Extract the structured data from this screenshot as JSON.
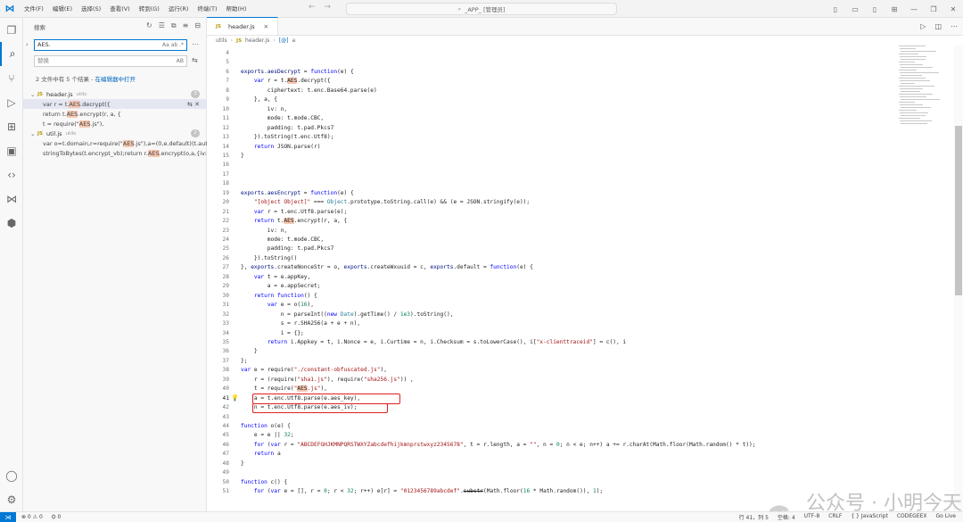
{
  "titlebar": {
    "menu": [
      "文件(F)",
      "编辑(E)",
      "选择(S)",
      "查看(V)",
      "转到(G)",
      "运行(R)",
      "终端(T)",
      "帮助(H)"
    ],
    "command_center": "_APP_ [管理员]"
  },
  "sidebar": {
    "title": "搜索",
    "search_value": "AES.",
    "search_options": "Aa ab .*",
    "replace_placeholder": "替换",
    "replace_option": "AB",
    "summary": "2 文件中有 5 个结果 - ",
    "summary_link": "在编辑器中打开",
    "files": [
      {
        "name": "header.js",
        "dir": "utils",
        "count": "3",
        "matches": [
          {
            "pre": "var r = t.",
            "hit": "AES",
            "post": ".decrypt({"
          },
          {
            "pre": "return t.",
            "hit": "AES",
            "post": ".encrypt(r, a, {"
          },
          {
            "pre": "t = require(\"",
            "hit": "AES",
            "post": ".js\"),"
          }
        ]
      },
      {
        "name": "util.js",
        "dir": "utils",
        "count": "2",
        "matches": [
          {
            "pre": "var o=t.domain,r=require(\"",
            "hit": "AES",
            "post": ".js\"),a=(0,e.default)(t.aut..."
          },
          {
            "pre": "stringToBytes(t.encrypt_vb);return r.",
            "hit": "AES",
            "post": ".encrypt(o,a,{iv:s..."
          }
        ]
      }
    ]
  },
  "editor": {
    "tab_label": "header.js",
    "breadcrumb": [
      "utils",
      "header.js",
      "a"
    ],
    "current_line": 41
  },
  "code_lines": [
    [
      4,
      []
    ],
    [
      5,
      []
    ],
    [
      6,
      [
        [
          "prop",
          "exports"
        ],
        [
          "",
          "."
        ],
        [
          "prop",
          "aesDecrypt"
        ],
        [
          "",
          " = "
        ],
        [
          "kw",
          "function"
        ],
        [
          "",
          "(e) {"
        ]
      ]
    ],
    [
      7,
      [
        [
          "",
          "    "
        ],
        [
          "kw",
          "var"
        ],
        [
          "",
          " r = t."
        ],
        [
          "hl",
          "AES"
        ],
        [
          "",
          ".decrypt({"
        ]
      ]
    ],
    [
      8,
      [
        [
          "",
          "        ciphertext: t.enc.Base64.parse(e)"
        ]
      ]
    ],
    [
      9,
      [
        [
          "",
          "    }, a, {"
        ]
      ]
    ],
    [
      10,
      [
        [
          "",
          "        iv: n,"
        ]
      ]
    ],
    [
      11,
      [
        [
          "",
          "        mode: t.mode.CBC,"
        ]
      ]
    ],
    [
      12,
      [
        [
          "",
          "        padding: t.pad.Pkcs7"
        ]
      ]
    ],
    [
      13,
      [
        [
          "",
          "    }).toString(t.enc.Utf8);"
        ]
      ]
    ],
    [
      14,
      [
        [
          "",
          "    "
        ],
        [
          "kw",
          "return"
        ],
        [
          "",
          " JSON.parse(r)"
        ]
      ]
    ],
    [
      15,
      [
        [
          "",
          "}"
        ]
      ]
    ],
    [
      16,
      []
    ],
    [
      17,
      []
    ],
    [
      18,
      []
    ],
    [
      19,
      [
        [
          "prop",
          "exports"
        ],
        [
          "",
          "."
        ],
        [
          "prop",
          "aesEncrypt"
        ],
        [
          "",
          " = "
        ],
        [
          "kw",
          "function"
        ],
        [
          "",
          "(e) {"
        ]
      ]
    ],
    [
      20,
      [
        [
          "",
          "    "
        ],
        [
          "str",
          "\"[object Object]\""
        ],
        [
          "",
          " === "
        ],
        [
          "cls",
          "Object"
        ],
        [
          "",
          ".prototype.toString.call(e) && (e = JSON.stringify(e));"
        ]
      ]
    ],
    [
      21,
      [
        [
          "",
          "    "
        ],
        [
          "kw",
          "var"
        ],
        [
          "",
          " r = t.enc.Utf8.parse(e);"
        ]
      ]
    ],
    [
      22,
      [
        [
          "",
          "    "
        ],
        [
          "kw",
          "return"
        ],
        [
          "",
          " t."
        ],
        [
          "hl",
          "AES"
        ],
        [
          "",
          ".encrypt(r, a, {"
        ]
      ]
    ],
    [
      23,
      [
        [
          "",
          "        iv: n,"
        ]
      ]
    ],
    [
      24,
      [
        [
          "",
          "        mode: t.mode.CBC,"
        ]
      ]
    ],
    [
      25,
      [
        [
          "",
          "        padding: t.pad.Pkcs7"
        ]
      ]
    ],
    [
      26,
      [
        [
          "",
          "    }).toString()"
        ]
      ]
    ],
    [
      27,
      [
        [
          "",
          "}, "
        ],
        [
          "prop",
          "exports"
        ],
        [
          "",
          ".createNonceStr = o, "
        ],
        [
          "prop",
          "exports"
        ],
        [
          "",
          ".createWxuuid = c, "
        ],
        [
          "prop",
          "exports"
        ],
        [
          "",
          ".default = "
        ],
        [
          "kw",
          "function"
        ],
        [
          "",
          "(e) {"
        ]
      ]
    ],
    [
      28,
      [
        [
          "",
          "    "
        ],
        [
          "kw",
          "var"
        ],
        [
          "",
          " t = e.appKey,"
        ]
      ]
    ],
    [
      29,
      [
        [
          "",
          "        a = e.appSecret;"
        ]
      ]
    ],
    [
      30,
      [
        [
          "",
          "    "
        ],
        [
          "kw",
          "return"
        ],
        [
          "",
          " "
        ],
        [
          "kw",
          "function"
        ],
        [
          "",
          "() {"
        ]
      ]
    ],
    [
      31,
      [
        [
          "",
          "        "
        ],
        [
          "kw",
          "var"
        ],
        [
          "",
          " e = o("
        ],
        [
          "num",
          "16"
        ],
        [
          "",
          "),"
        ]
      ]
    ],
    [
      32,
      [
        [
          "",
          "            n = parseInt(("
        ],
        [
          "kw",
          "new"
        ],
        [
          "",
          " "
        ],
        [
          "cls",
          "Date"
        ],
        [
          "",
          ").getTime() / "
        ],
        [
          "num",
          "1e3"
        ],
        [
          "",
          ").toString(),"
        ]
      ]
    ],
    [
      33,
      [
        [
          "",
          "            s = r.SHA256(a + e + n),"
        ]
      ]
    ],
    [
      34,
      [
        [
          "",
          "            i = {};"
        ]
      ]
    ],
    [
      35,
      [
        [
          "",
          "        "
        ],
        [
          "kw",
          "return"
        ],
        [
          "",
          " i.Appkey = t, i.Nonce = e, i.Curtime = n, i.Checksum = s.toLowerCase(), i["
        ],
        [
          "str",
          "\"x-clienttraceid\""
        ],
        [
          "",
          "] = c(), i"
        ]
      ]
    ],
    [
      36,
      [
        [
          "",
          "    }"
        ]
      ]
    ],
    [
      37,
      [
        [
          "",
          "};"
        ]
      ]
    ],
    [
      38,
      [
        [
          "kw",
          "var"
        ],
        [
          "",
          " e = require("
        ],
        [
          "str",
          "\"./constant-obfuscated.js\""
        ],
        [
          "",
          "),"
        ]
      ]
    ],
    [
      39,
      [
        [
          "",
          "    r = (require("
        ],
        [
          "str",
          "\"sha1.js\""
        ],
        [
          "",
          "), require("
        ],
        [
          "str",
          "\"sha256.js\""
        ],
        [
          "",
          "))"
        ],
        [
          "",
          " ,"
        ]
      ]
    ],
    [
      40,
      [
        [
          "",
          "    t = require("
        ],
        [
          "str",
          "\""
        ],
        [
          "hls",
          "AES"
        ],
        [
          "str",
          ".js\""
        ],
        [
          "",
          "),"
        ]
      ]
    ],
    [
      41,
      [
        [
          "",
          "    a = t.enc.Utf8.parse(e.aes_key),"
        ]
      ]
    ],
    [
      42,
      [
        [
          "",
          "    n = t.enc.Utf8.parse(e.aes_iv);"
        ]
      ]
    ],
    [
      43,
      []
    ],
    [
      44,
      [
        [
          "kw",
          "function"
        ],
        [
          "",
          " o(e) {"
        ]
      ]
    ],
    [
      45,
      [
        [
          "",
          "    e = e || "
        ],
        [
          "num",
          "32"
        ],
        [
          "",
          ";"
        ]
      ]
    ],
    [
      46,
      [
        [
          "",
          "    "
        ],
        [
          "kw",
          "for"
        ],
        [
          "",
          " ("
        ],
        [
          "kw",
          "var"
        ],
        [
          "",
          " r = "
        ],
        [
          "str",
          "\"ABCDEFGHJKMNPQRSTWXYZabcdefhijkmnprstwxyz2345678\""
        ],
        [
          "",
          ", t = r.length, a = "
        ],
        [
          "str",
          "\"\""
        ],
        [
          "",
          ", n = "
        ],
        [
          "num",
          "0"
        ],
        [
          "",
          "; n < e; n++) a += r.charAt(Math.floor(Math.random() * t));"
        ]
      ]
    ],
    [
      47,
      [
        [
          "",
          "    "
        ],
        [
          "kw",
          "return"
        ],
        [
          "",
          " a"
        ]
      ]
    ],
    [
      48,
      [
        [
          "",
          "}"
        ]
      ]
    ],
    [
      49,
      []
    ],
    [
      50,
      [
        [
          "kw",
          "function"
        ],
        [
          "",
          " c() {"
        ]
      ]
    ],
    [
      51,
      [
        [
          "",
          "    "
        ],
        [
          "kw",
          "for"
        ],
        [
          "",
          " ("
        ],
        [
          "kw",
          "var"
        ],
        [
          "",
          " e = [], r = "
        ],
        [
          "num",
          "0"
        ],
        [
          "",
          "; r < "
        ],
        [
          "num",
          "32"
        ],
        [
          "",
          "; r++) e[r] = "
        ],
        [
          "str",
          "\"0123456789abcdef\""
        ],
        [
          "",
          "."
        ],
        [
          "strike",
          "substr"
        ],
        [
          "",
          "(Math.floor("
        ],
        [
          "num",
          "16"
        ],
        [
          "",
          " * Math.random()), "
        ],
        [
          "num",
          "1"
        ],
        [
          "",
          ");"
        ]
      ]
    ]
  ],
  "watermark": {
    "text": "公众号 · 小明今天拿站了吗"
  },
  "statusbar": {
    "left": [
      "⊗ 0 ⚠ 0",
      "⛭ 0"
    ],
    "right": [
      "行 41，列 5",
      "空格: 4",
      "UTF-8",
      "CRLF",
      "{ } JavaScript",
      "CODEGEEX",
      "Go Live"
    ]
  },
  "colors": {
    "accent": "#0078d4",
    "highlight": "#f6c8b2",
    "annotation_box": "#e02020",
    "keyword": "#0000ff",
    "string": "#a31515"
  }
}
